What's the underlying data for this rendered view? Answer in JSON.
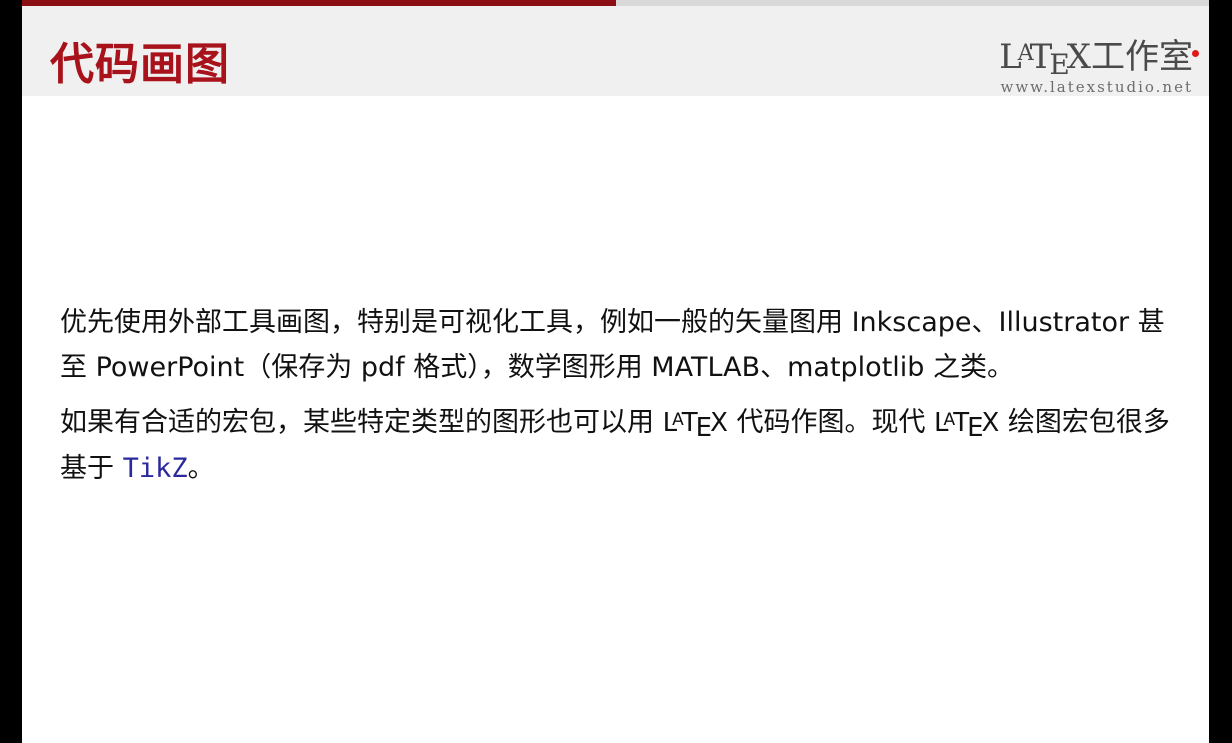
{
  "slide": {
    "progress_fraction": 0.5,
    "title": "代码画图",
    "logo": {
      "text_L": "L",
      "text_A": "A",
      "text_T": "T",
      "text_E": "E",
      "text_X": "X",
      "text_cn": "工作室",
      "url": "www.latexstudio.net"
    },
    "para1": {
      "text": "优先使用外部工具画图，特别是可视化工具，例如一般的矢量图用 Inkscape、Illustrator 甚至 PowerPoint（保存为 pdf 格式），数学图形用 MATLAB、matplotlib 之类。"
    },
    "para2": {
      "text_a": "如果有合适的宏包，某些特定类型的图形也可以用 ",
      "text_b": " 代码作图。现代 ",
      "text_c": " 绘图宏包很多基于 ",
      "code": "TikZ",
      "text_d": "。"
    },
    "latex_logo": {
      "L": "L",
      "A": "A",
      "T": "T",
      "E": "E",
      "X": "X"
    }
  }
}
